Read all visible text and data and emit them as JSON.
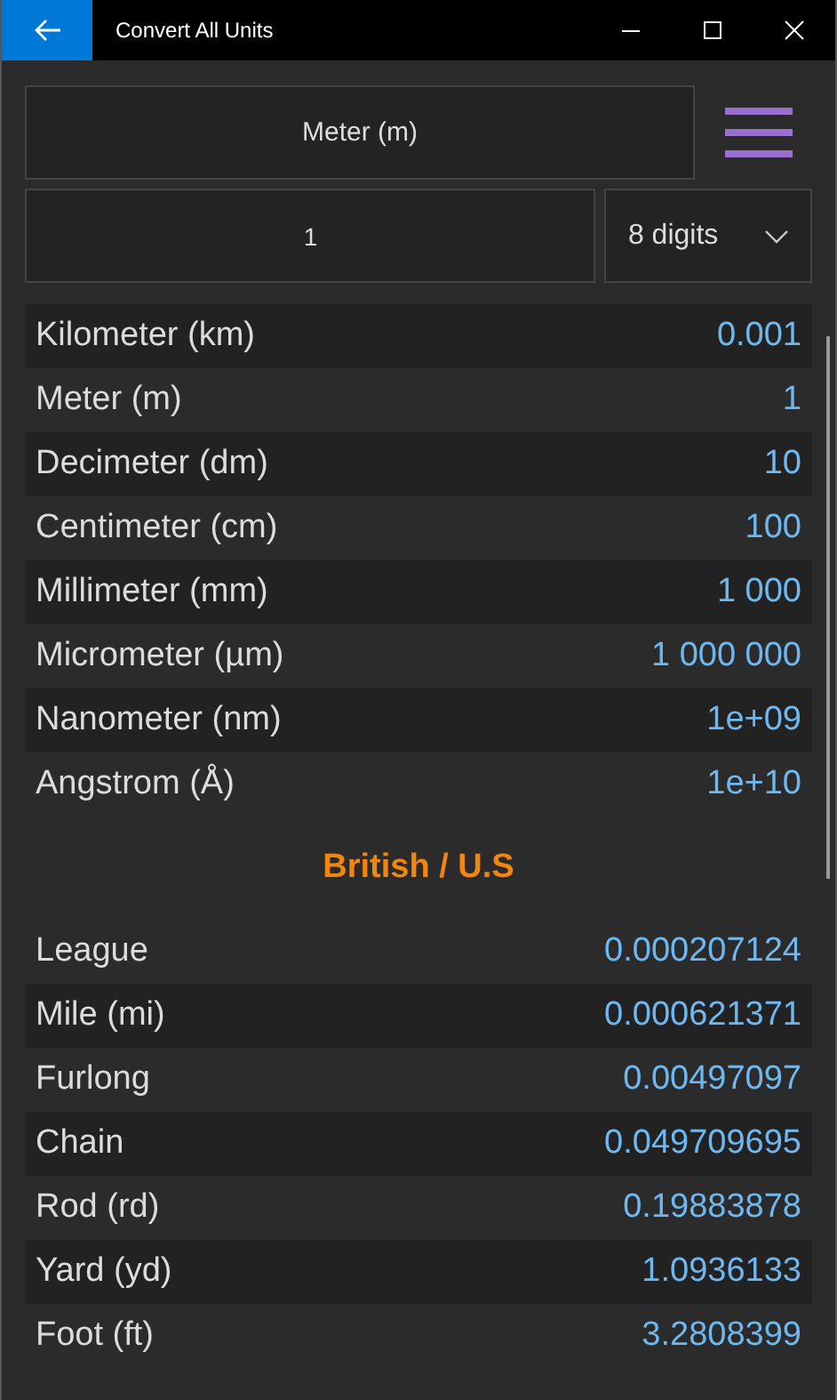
{
  "window": {
    "title": "Convert All Units"
  },
  "unit_selector": {
    "value": "Meter (m)"
  },
  "amount_field": {
    "value": "1"
  },
  "precision_dropdown": {
    "value": "8 digits"
  },
  "groups": [
    {
      "rows": [
        {
          "unit": "Kilometer (km)",
          "value": "0.001"
        },
        {
          "unit": "Meter (m)",
          "value": "1"
        },
        {
          "unit": "Decimeter (dm)",
          "value": "10"
        },
        {
          "unit": "Centimeter (cm)",
          "value": "100"
        },
        {
          "unit": "Millimeter (mm)",
          "value": "1 000"
        },
        {
          "unit": "Micrometer (µm)",
          "value": "1 000 000"
        },
        {
          "unit": "Nanometer (nm)",
          "value": "1e+09"
        },
        {
          "unit": "Angstrom (Å)",
          "value": "1e+10"
        }
      ]
    },
    {
      "header": "British / U.S",
      "rows": [
        {
          "unit": "League",
          "value": "0.000207124"
        },
        {
          "unit": "Mile (mi)",
          "value": "0.000621371"
        },
        {
          "unit": "Furlong",
          "value": "0.00497097"
        },
        {
          "unit": "Chain",
          "value": "0.049709695"
        },
        {
          "unit": "Rod (rd)",
          "value": "0.19883878"
        },
        {
          "unit": "Yard (yd)",
          "value": "1.0936133"
        },
        {
          "unit": "Foot (ft)",
          "value": "3.2808399"
        }
      ]
    }
  ]
}
